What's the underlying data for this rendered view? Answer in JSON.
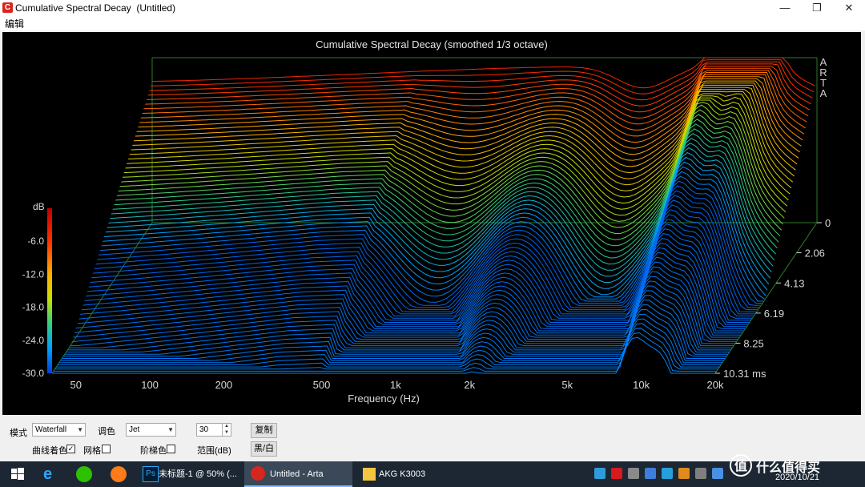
{
  "window": {
    "title": "Cumulative Spectral Decay  (Untitled)",
    "min_glyph": "—",
    "max_glyph": "❐",
    "close_glyph": "✕"
  },
  "menu": {
    "edit": "编辑"
  },
  "plot": {
    "title": "Cumulative Spectral Decay (smoothed 1/3 octave)",
    "watermark": "ARTA"
  },
  "chart_data": {
    "type": "waterfall",
    "title": "Cumulative Spectral Decay (smoothed 1/3 octave)",
    "xlabel": "Frequency (Hz)",
    "xscale": "log",
    "xlim": [
      40,
      20000
    ],
    "x_ticks": [
      "50",
      "100",
      "200",
      "500",
      "1k",
      "2k",
      "5k",
      "10k",
      "20k"
    ],
    "ylabel": "dB",
    "ylim": [
      -30,
      0
    ],
    "y_ticks": [
      "-6.0",
      "-12.0",
      "-18.0",
      "-24.0",
      "-30.0"
    ],
    "zlabel": "ms",
    "z_ticks": [
      "0",
      "2.06",
      "4.13",
      "6.19",
      "8.25",
      "10.31 ms"
    ],
    "zlim": [
      0,
      10.31
    ],
    "colormap": "Jet",
    "colorbar": [
      "#c00000",
      "#ff3000",
      "#ffb000",
      "#c8e000",
      "#30d080",
      "#00a0ff",
      "#0040e0"
    ]
  },
  "controls": {
    "mode_label": "模式",
    "mode_value": "Waterfall",
    "palette_label": "调色",
    "palette_value": "Jet",
    "range_value": "30",
    "copy_label": "复制",
    "curve_color_label": "曲线着色",
    "curve_color_checked": true,
    "grid_label": "网格",
    "grid_checked": false,
    "step_color_label": "阶梯色",
    "step_color_checked": false,
    "range_label": "范围(dB)",
    "bw_label": "黑/白"
  },
  "taskbar": {
    "tasks": [
      {
        "label": "未标题-1 @ 50% (...",
        "icon": "photoshop-icon"
      },
      {
        "label": "Untitled - Arta",
        "icon": "arta-icon"
      },
      {
        "label": "AKG K3003",
        "icon": "folder-icon"
      }
    ],
    "date": "2020/10/21",
    "watermark": "值 什么值得买"
  }
}
